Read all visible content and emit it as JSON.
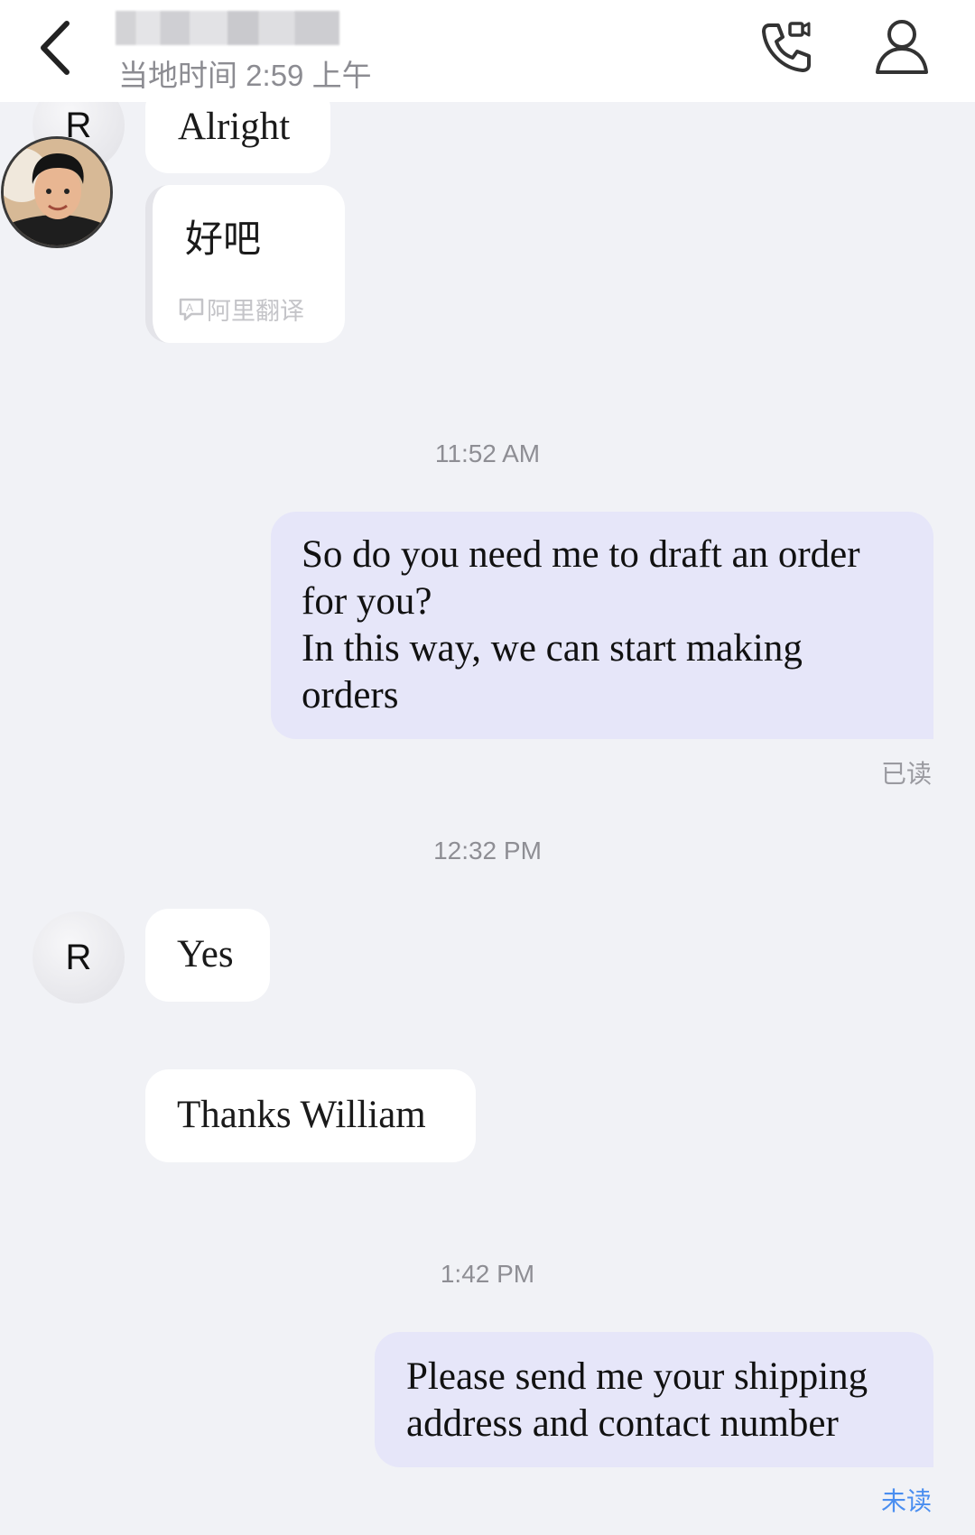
{
  "header": {
    "back_icon": "chevron-left-icon",
    "contact_name_blurred": true,
    "local_time": "当地时间 2:59 上午",
    "call_icon": "video-call-phone-icon",
    "profile_icon": "user-profile-icon"
  },
  "messages": [
    {
      "from": "contact",
      "avatar": "R",
      "text": "Alright"
    },
    {
      "from": "contact",
      "text": "好吧",
      "translation_label": "阿里翻译"
    },
    {
      "type": "timestamp",
      "text": "11:52 AM"
    },
    {
      "from": "me",
      "text_lines": [
        "So do you need me to draft an order",
        "for you?",
        "In this way, we can start making",
        "orders"
      ],
      "status": "已读"
    },
    {
      "type": "timestamp",
      "text": "12:32 PM"
    },
    {
      "from": "contact",
      "avatar": "R",
      "text": "Yes"
    },
    {
      "from": "contact",
      "text": "Thanks William"
    },
    {
      "type": "timestamp",
      "text": "1:42 PM"
    },
    {
      "from": "me",
      "text_lines": [
        "Please send me your shipping",
        "address and contact number"
      ],
      "status": "未读"
    }
  ],
  "colors": {
    "background": "#f1f2f6",
    "outgoing_bubble": "#e6e6f9",
    "incoming_bubble": "#ffffff",
    "read_status": "#9a9aa0",
    "unread_status": "#4a8ef0"
  }
}
